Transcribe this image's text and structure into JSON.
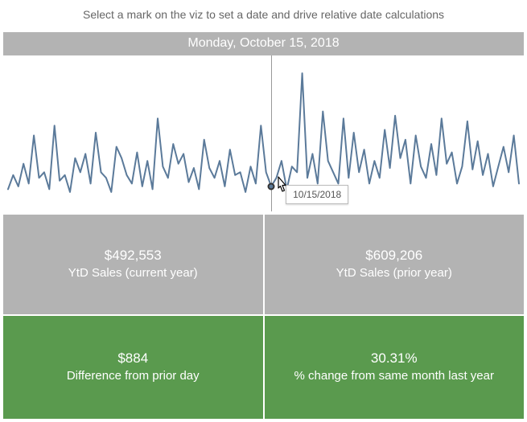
{
  "instruction": "Select a mark on the viz to set a date and drive relative date calculations",
  "selected_date_long": "Monday, October 15, 2018",
  "tooltip_date": "10/15/2018",
  "metrics": {
    "ytd_current": {
      "value": "$492,553",
      "label": "YtD Sales (current year)"
    },
    "ytd_prior": {
      "value": "$609,206",
      "label": "YtD Sales (prior year)"
    },
    "diff_day": {
      "value": "$884",
      "label": "Difference from prior day"
    },
    "pct_change": {
      "value": "30.31%",
      "label": "% change from same month last year"
    }
  },
  "colors": {
    "line": "#5b7a9a",
    "gray": "#b3b3b3",
    "green": "#5a9a4e"
  },
  "chart_data": {
    "type": "line",
    "title": "",
    "xlabel": "",
    "ylabel": "",
    "ylim": [
      0,
      100
    ],
    "selected_index": 51,
    "x": [
      0,
      1,
      2,
      3,
      4,
      5,
      6,
      7,
      8,
      9,
      10,
      11,
      12,
      13,
      14,
      15,
      16,
      17,
      18,
      19,
      20,
      21,
      22,
      23,
      24,
      25,
      26,
      27,
      28,
      29,
      30,
      31,
      32,
      33,
      34,
      35,
      36,
      37,
      38,
      39,
      40,
      41,
      42,
      43,
      44,
      45,
      46,
      47,
      48,
      49,
      50,
      51,
      52,
      53,
      54,
      55,
      56,
      57,
      58,
      59,
      60,
      61,
      62,
      63,
      64,
      65,
      66,
      67,
      68,
      69,
      70,
      71,
      72,
      73,
      74,
      75,
      76,
      77,
      78,
      79,
      80,
      81,
      82,
      83,
      84,
      85,
      86,
      87,
      88,
      89,
      90,
      91,
      92,
      93,
      94,
      95,
      96,
      97,
      98,
      99
    ],
    "values": [
      10,
      20,
      12,
      28,
      14,
      48,
      18,
      22,
      10,
      55,
      16,
      20,
      8,
      32,
      22,
      35,
      14,
      50,
      22,
      18,
      8,
      40,
      32,
      20,
      14,
      36,
      12,
      30,
      10,
      60,
      26,
      18,
      42,
      28,
      35,
      15,
      25,
      10,
      45,
      25,
      18,
      30,
      12,
      38,
      20,
      22,
      8,
      26,
      14,
      55,
      22,
      12,
      18,
      30,
      10,
      26,
      22,
      92,
      18,
      35,
      14,
      65,
      30,
      22,
      14,
      60,
      18,
      50,
      22,
      38,
      14,
      30,
      18,
      52,
      25,
      62,
      32,
      45,
      14,
      48,
      26,
      18,
      42,
      20,
      60,
      28,
      36,
      14,
      26,
      58,
      24,
      44,
      20,
      35,
      12,
      26,
      40,
      22,
      48,
      14
    ]
  }
}
